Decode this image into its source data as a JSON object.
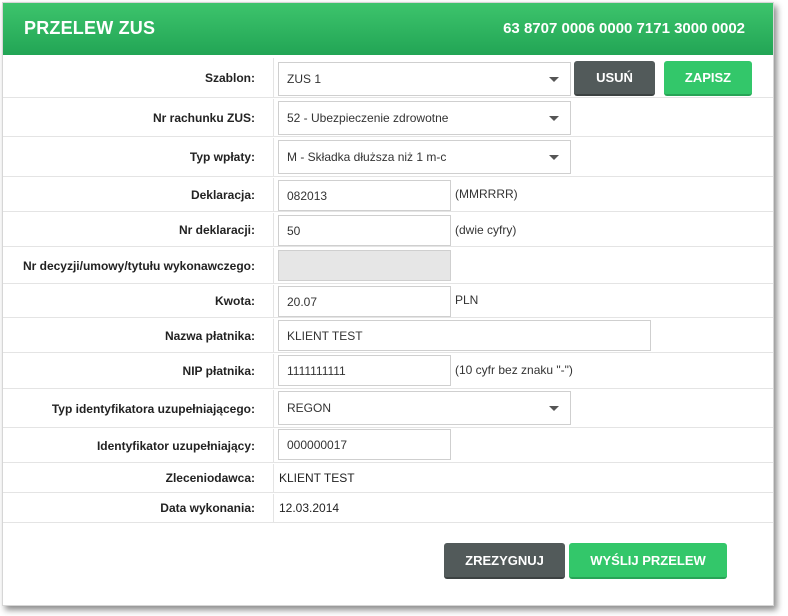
{
  "header": {
    "title": "PRZELEW ZUS",
    "account_number": "63 8707 0006 0000 7171 3000 0002"
  },
  "form": {
    "template": {
      "label": "Szablon:",
      "value": "ZUS 1",
      "delete_label": "USUŃ",
      "save_label": "ZAPISZ"
    },
    "zus_account": {
      "label": "Nr rachunku ZUS:",
      "value": "52 - Ubezpieczenie zdrowotne"
    },
    "payment_type": {
      "label": "Typ wpłaty:",
      "value": "M - Składka dłuższa niż 1 m-c"
    },
    "declaration": {
      "label": "Deklaracja:",
      "value": "082013",
      "hint": "(MMRRRR)"
    },
    "declaration_number": {
      "label": "Nr deklaracji:",
      "value": "50",
      "hint": "(dwie cyfry)"
    },
    "decision_number": {
      "label": "Nr decyzji/umowy/tytułu wykonawczego:",
      "value": ""
    },
    "amount": {
      "label": "Kwota:",
      "value": "20.07",
      "currency": "PLN"
    },
    "payer_name": {
      "label": "Nazwa płatnika:",
      "value": "KLIENT TEST"
    },
    "payer_nip": {
      "label": "NIP płatnika:",
      "value": "1111111111",
      "hint": "(10 cyfr bez znaku \"-\")"
    },
    "supp_id_type": {
      "label": "Typ identyfikatora uzupełniającego:",
      "value": "REGON"
    },
    "supp_id": {
      "label": "Identyfikator uzupełniający:",
      "value": "000000017"
    },
    "ordering_party": {
      "label": "Zleceniodawca:",
      "value": "KLIENT TEST"
    },
    "execution_date": {
      "label": "Data wykonania:",
      "value": "12.03.2014"
    }
  },
  "actions": {
    "cancel_label": "ZREZYGNUJ",
    "send_label": "WYŚLIJ PRZELEW"
  },
  "colors": {
    "header_green": "#2bb35e",
    "primary_button": "#33c76a",
    "secondary_button": "#525a5a"
  }
}
